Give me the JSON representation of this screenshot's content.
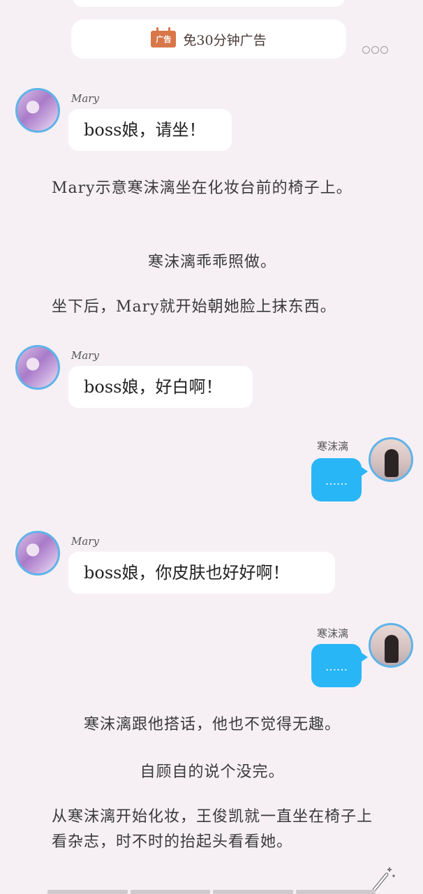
{
  "ad_bar": {
    "icon_text": "广告",
    "label": "免30分钟广告"
  },
  "messages": [
    {
      "speaker": "Mary",
      "text": "boss娘，请坐！"
    },
    {
      "speaker": "Mary",
      "text": "boss娘，好白啊！"
    },
    {
      "speaker": "寒沫漓",
      "text": "……"
    },
    {
      "speaker": "Mary",
      "text": "boss娘，你皮肤也好好啊！"
    },
    {
      "speaker": "寒沫漓",
      "text": "……"
    }
  ],
  "narration": [
    "Mary示意寒沫漓坐在化妆台前的椅子上。",
    "寒沫漓乖乖照做。",
    "坐下后，Mary就开始朝她脸上抹东西。",
    "寒沫漓跟他搭话，他也不觉得无趣。",
    "自顾自的说个没完。",
    "从寒沫漓开始化妆，王俊凯就一直坐在椅子上看杂志，时不时的抬起头看看她。"
  ],
  "icons": {
    "more": "more-options-icon",
    "magic": "magic-wand-icon",
    "ad": "ad-calendar-icon"
  },
  "colors": {
    "background": "#f6f0f5",
    "bubble_blue": "#29b6f6",
    "avatar_ring": "#5fb3e8",
    "ad_icon": "#d9774a"
  }
}
